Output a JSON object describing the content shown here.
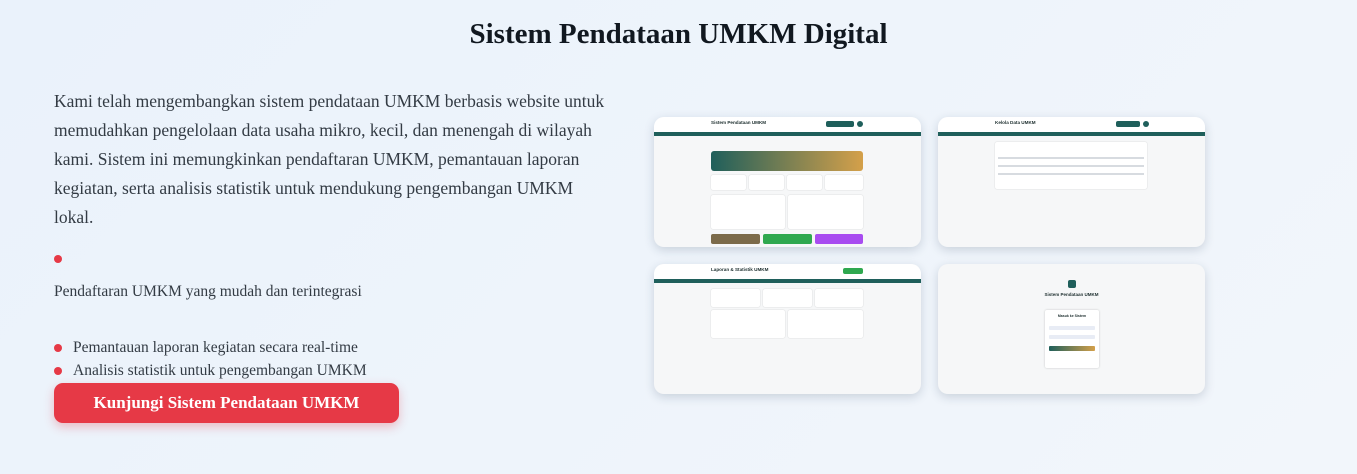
{
  "page": {
    "title": "Sistem Pendataan UMKM Digital",
    "description": "Kami telah mengembangkan sistem pendataan UMKM berbasis website untuk memudahkan pengelolaan data usaha mikro, kecil, dan menengah di wilayah kami. Sistem ini memungkinkan pendaftaran UMKM, pemantauan laporan kegiatan, serta analisis statistik untuk mendukung pengembangan UMKM lokal.",
    "features": [
      "Pendaftaran UMKM yang mudah dan terintegrasi",
      "Pemantauan laporan kegiatan secara real-time",
      "Analisis statistik untuk pengembangan UMKM"
    ],
    "cta_label": "Kunjungi Sistem Pendataan UMKM"
  },
  "screenshots": {
    "dashboard_title": "Sistem Pendataan UMKM",
    "data_title": "Kelola Data UMKM",
    "report_title": "Laporan & Statistik UMKM",
    "login_title": "Sistem Pendataan UMKM",
    "login_card_title": "Masuk ke Sistem"
  },
  "colors": {
    "accent": "#e63946",
    "brand": "#1f5f5b"
  }
}
